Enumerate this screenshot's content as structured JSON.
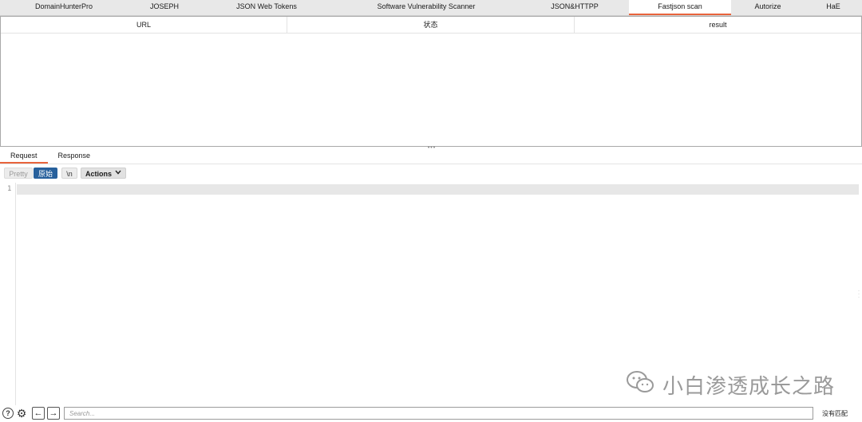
{
  "extension_tabs": [
    {
      "label": "DomainHunterPro",
      "active": false
    },
    {
      "label": "JOSEPH",
      "active": false
    },
    {
      "label": "JSON Web Tokens",
      "active": false
    },
    {
      "label": "Software Vulnerability Scanner",
      "active": false
    },
    {
      "label": "JSON&HTTPP",
      "active": false
    },
    {
      "label": "Fastjson scan",
      "active": true
    },
    {
      "label": "Autorize",
      "active": false
    },
    {
      "label": "HaE",
      "active": false
    }
  ],
  "table": {
    "columns": [
      "URL",
      "状态",
      "result"
    ],
    "rows": []
  },
  "message_tabs": [
    {
      "label": "Request",
      "active": true
    },
    {
      "label": "Response",
      "active": false
    }
  ],
  "editor_toolbar": {
    "pretty": "Pretty",
    "raw": "原始",
    "newline": "\\n",
    "actions": "Actions"
  },
  "editor": {
    "line_number": "1",
    "content": ""
  },
  "watermark": {
    "text": "小白渗透成长之路"
  },
  "bottom_bar": {
    "search_placeholder": "Search...",
    "match_status": "没有匹配"
  },
  "colors": {
    "accent": "#e8643c",
    "raw_button": "#27609c",
    "tab_bar": "#e8e8e8"
  }
}
